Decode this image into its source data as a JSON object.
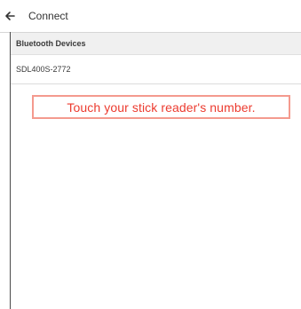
{
  "app_bar": {
    "title": "Connect",
    "back_icon": "arrow-left-icon"
  },
  "section": {
    "header": "Bluetooth Devices"
  },
  "devices": [
    {
      "name": "SDL400S-2772"
    }
  ],
  "hint": {
    "text": "Touch your stick reader's number."
  },
  "colors": {
    "hint_text": "#ec3b2f",
    "hint_border": "#f49a8e",
    "section_bg": "#f0f0f0"
  }
}
